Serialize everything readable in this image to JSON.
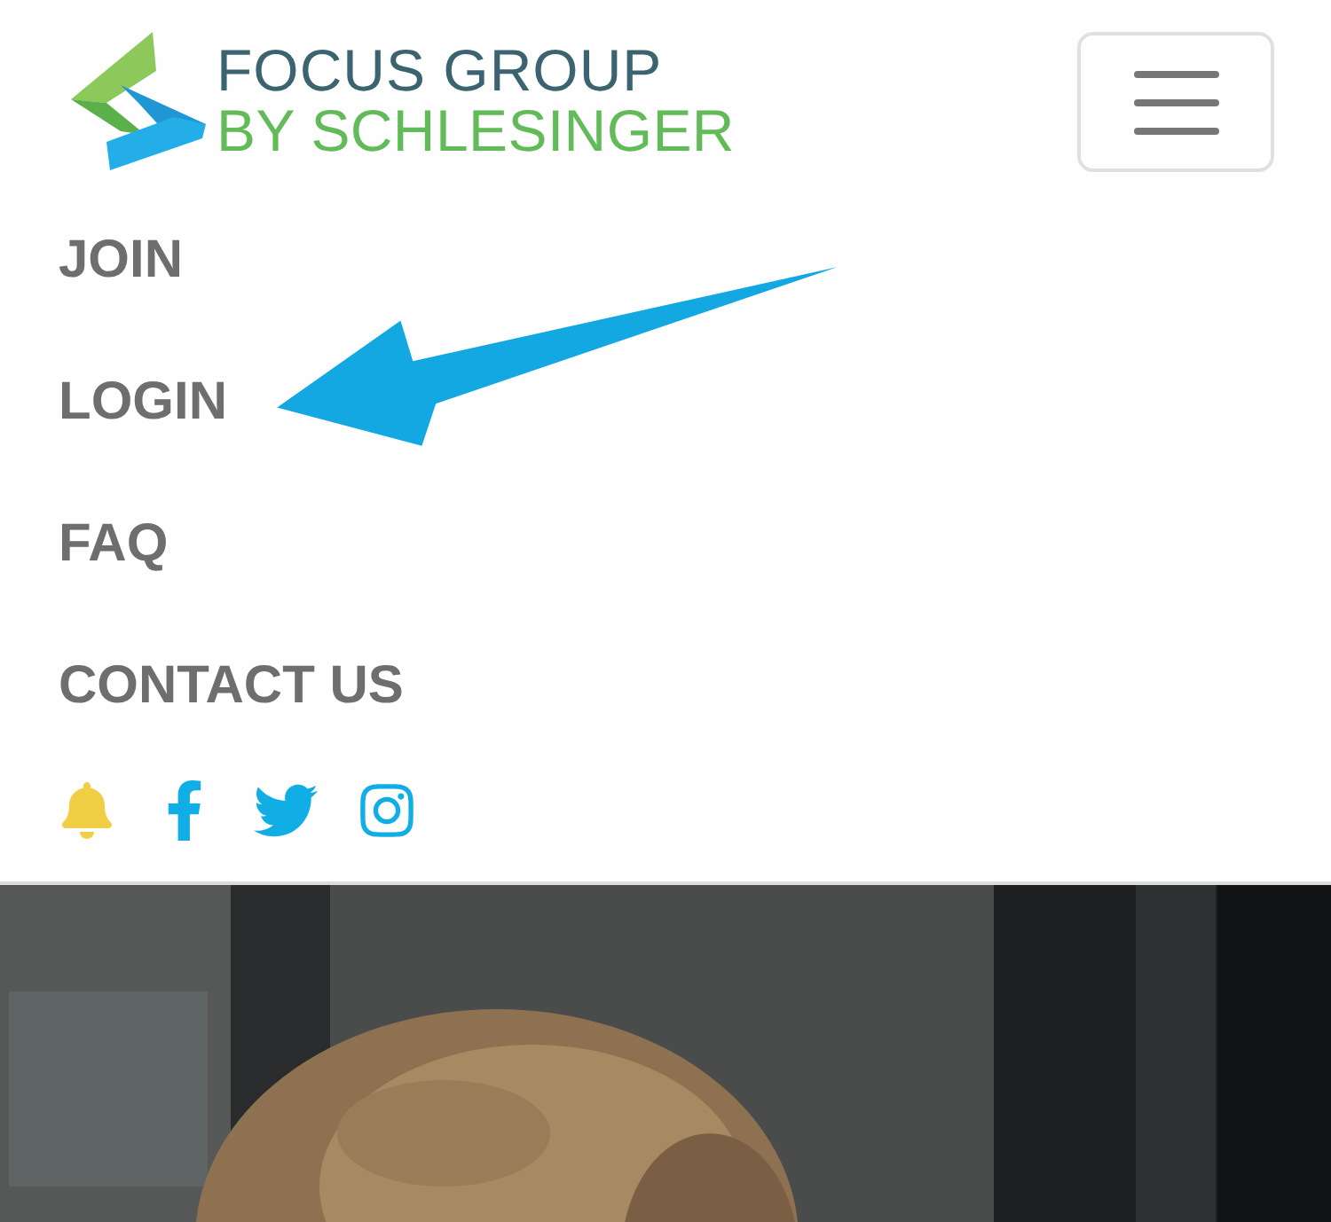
{
  "logo": {
    "line_1": "FOCUS GROUP",
    "line_2": "BY SCHLESINGER"
  },
  "nav": [
    {
      "label": "JOIN"
    },
    {
      "label": "LOGIN"
    },
    {
      "label": "FAQ"
    },
    {
      "label": "CONTACT US"
    }
  ]
}
